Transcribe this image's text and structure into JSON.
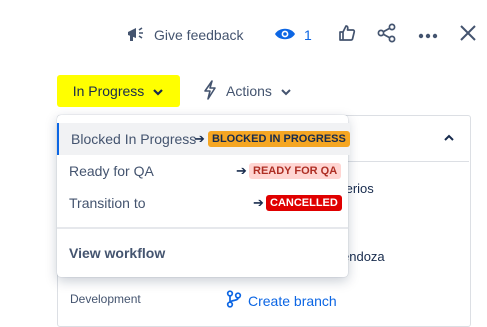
{
  "toolbar": {
    "feedback_label": "Give feedback",
    "watch_count": "1"
  },
  "status": {
    "label": "In Progress",
    "color": "#ffff00"
  },
  "actions": {
    "label": "Actions"
  },
  "menu": {
    "items": [
      {
        "label": "Blocked In Progress",
        "target": "BLOCKED IN PROGRESS",
        "target_bg": "#f5a623",
        "target_color": "#172b4d"
      },
      {
        "label": "Ready for QA",
        "target": "READY FOR QA",
        "target_bg": "#ffd5d2",
        "target_color": "#ae2e24"
      },
      {
        "label": "Transition to",
        "target": "CANCELLED",
        "target_bg": "#e00000",
        "target_color": "#ffffff"
      }
    ],
    "view_workflow": "View workflow"
  },
  "background": {
    "partial_text_1": "terios",
    "partial_text_2": "endoza",
    "development_label": "Development",
    "create_branch": "Create branch"
  }
}
